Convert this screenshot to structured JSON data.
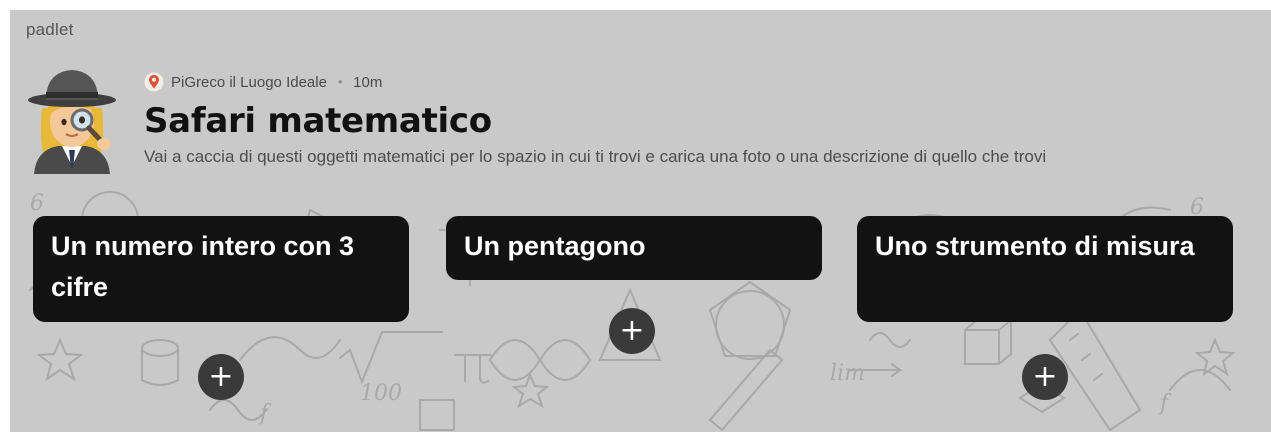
{
  "brand": "padlet",
  "header": {
    "author": "PiGreco il Luogo Ideale",
    "separator": "•",
    "time": "10m",
    "title": "Safari matematico",
    "description": "Vai a caccia di questi oggetti matematici per lo spazio in cui ti trovi e carica una foto o una descrizione di quello che trovi"
  },
  "columns": [
    {
      "title": "Un numero intero con 3 cifre",
      "add_label": "+"
    },
    {
      "title": "Un pentagono",
      "add_label": "+"
    },
    {
      "title": "Uno strumento di misura",
      "add_label": "+"
    }
  ],
  "icons": {
    "avatar": "detective-woman-icon",
    "author_badge": "location-pin-icon",
    "add": "plus-icon"
  },
  "colors": {
    "background": "#c9c9c9",
    "card": "#121212",
    "card_text": "#ffffff",
    "add_button": "#3a3a3a",
    "pin": "#e0523a"
  }
}
